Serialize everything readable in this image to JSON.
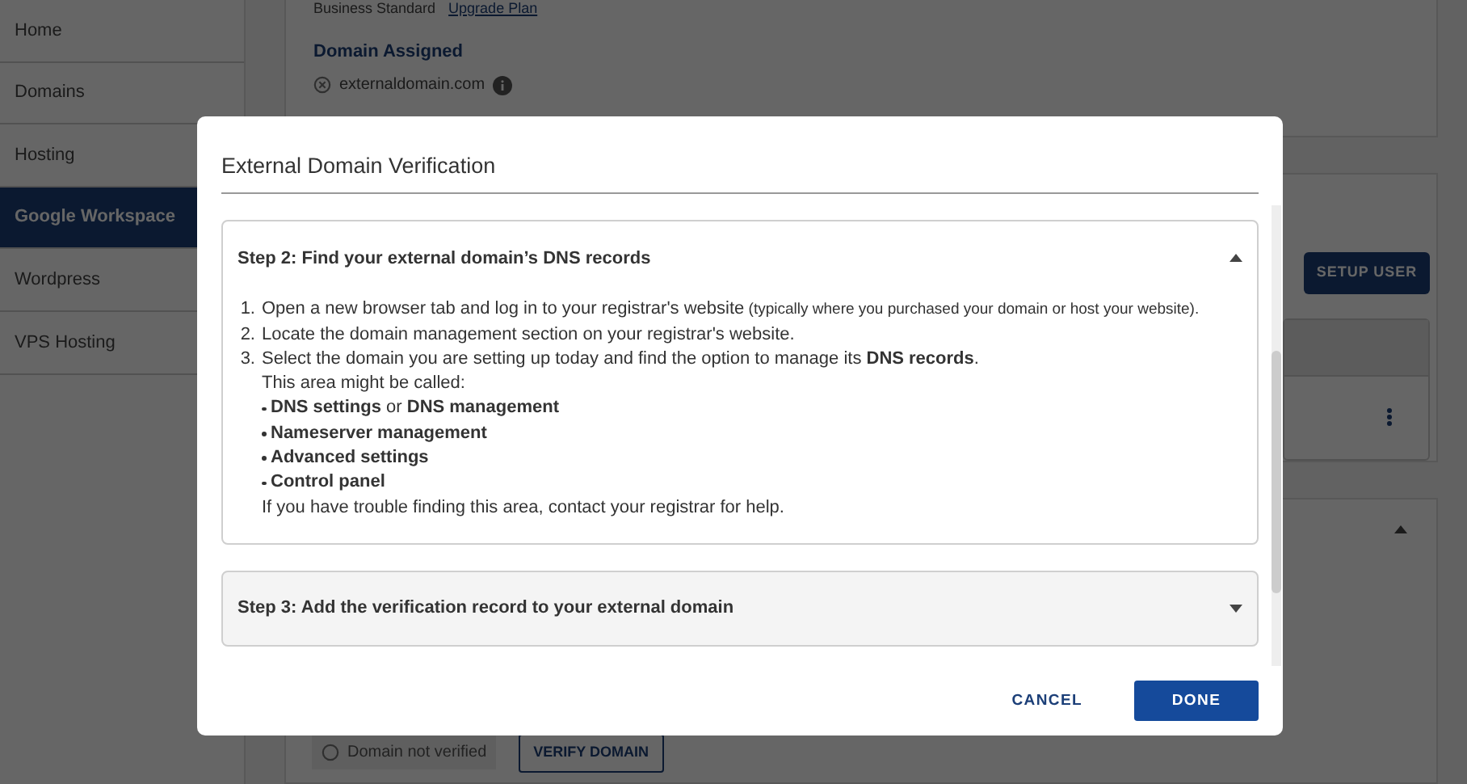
{
  "sidebar": {
    "items": [
      {
        "label": "Home",
        "selected": false
      },
      {
        "label": "Domains",
        "selected": false
      },
      {
        "label": "Hosting",
        "selected": false
      },
      {
        "label": "Google Workspace",
        "selected": true
      },
      {
        "label": "Wordpress",
        "selected": false
      },
      {
        "label": "VPS Hosting",
        "selected": false
      }
    ]
  },
  "plan_card": {
    "plan": "Business Standard",
    "upgrade_link": "Upgrade Plan",
    "domain_heading": "Domain Assigned",
    "domain": "externaldomain.com"
  },
  "users_card": {
    "setup_button": "SETUP USER"
  },
  "verify_card": {
    "status": "Domain not verified",
    "verify_button": "VERIFY DOMAIN"
  },
  "modal": {
    "title": "External Domain Verification",
    "steps": [
      {
        "title": "Step 2: Find your external domain’s DNS records",
        "expanded": true,
        "items": [
          {
            "number": "1.",
            "text": "Open a new browser tab and log in to your registrar's website",
            "aside": "(typically where you purchased your domain or host your website)."
          },
          {
            "number": "2.",
            "text": "Locate the domain management section on your registrar's website."
          },
          {
            "number": "3.",
            "text": "Select the domain you are setting up today and find the option to manage its **DNS records**."
          }
        ],
        "intro": "This area might be called:",
        "bullets": [
          "**DNS settings** or **DNS management**",
          "**Nameserver management**",
          "**Advanced settings**",
          "**Control panel**"
        ],
        "outro": "If you have trouble finding this area, contact your registrar for help."
      },
      {
        "title": "Step 3: Add the verification record to your external domain",
        "expanded": false
      }
    ],
    "cancel_button": "CANCEL",
    "done_button": "DONE"
  }
}
